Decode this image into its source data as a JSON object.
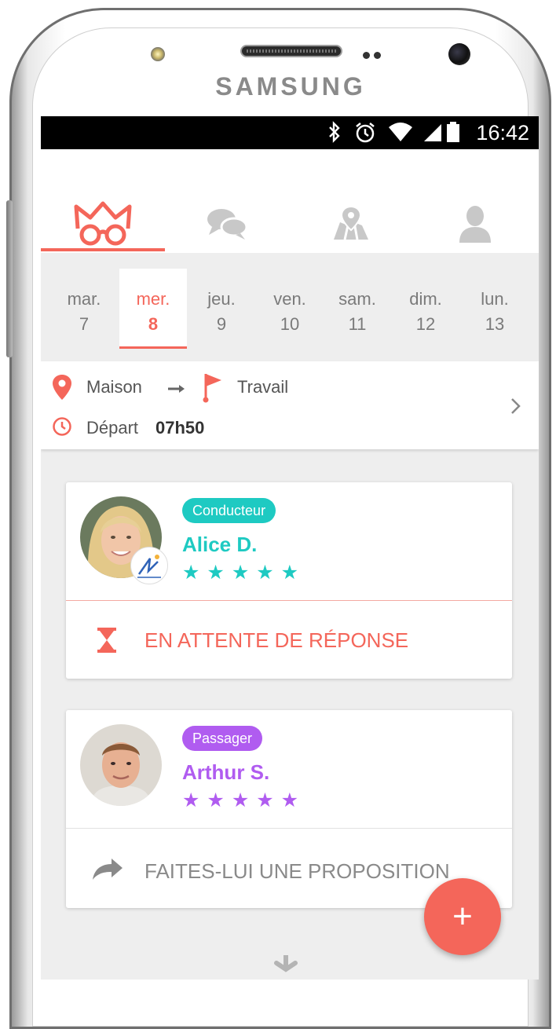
{
  "device": {
    "brand": "SAMSUNG"
  },
  "status_bar": {
    "time": "16:42",
    "icons": [
      "bluetooth-icon",
      "alarm-icon",
      "wifi-icon",
      "signal-icon",
      "battery-icon"
    ]
  },
  "tabs": [
    {
      "name": "crown-glasses-icon",
      "active": true
    },
    {
      "name": "chat-icon",
      "active": false
    },
    {
      "name": "map-icon",
      "active": false
    },
    {
      "name": "profile-icon",
      "active": false
    }
  ],
  "days": [
    {
      "name": "mar.",
      "date": "7"
    },
    {
      "name": "mer.",
      "date": "8"
    },
    {
      "name": "jeu.",
      "date": "9"
    },
    {
      "name": "ven.",
      "date": "10"
    },
    {
      "name": "sam.",
      "date": "11"
    },
    {
      "name": "dim.",
      "date": "12"
    },
    {
      "name": "lun.",
      "date": "13"
    }
  ],
  "selected_day_index": 1,
  "route": {
    "from": "Maison",
    "to": "Travail",
    "departure_label": "Départ",
    "departure_time": "07h50"
  },
  "cards": [
    {
      "role": "Conducteur",
      "name": "Alice D.",
      "rating": 5,
      "stars": "★★★★★",
      "action": "EN ATTENTE DE RÉPONSE",
      "accent": "#1ecac2",
      "action_color": "#f4665a"
    },
    {
      "role": "Passager",
      "name": "Arthur S.",
      "rating": 5,
      "stars": "★★★★★",
      "action": "FAITES-LUI UNE PROPOSITION",
      "accent": "#b05cf0",
      "action_color": "#8a8a8a"
    }
  ],
  "fab": {
    "label": "+"
  },
  "colors": {
    "primary": "#f4665a",
    "inactive_tab": "#c8c8c8",
    "background": "#eeeeee"
  }
}
